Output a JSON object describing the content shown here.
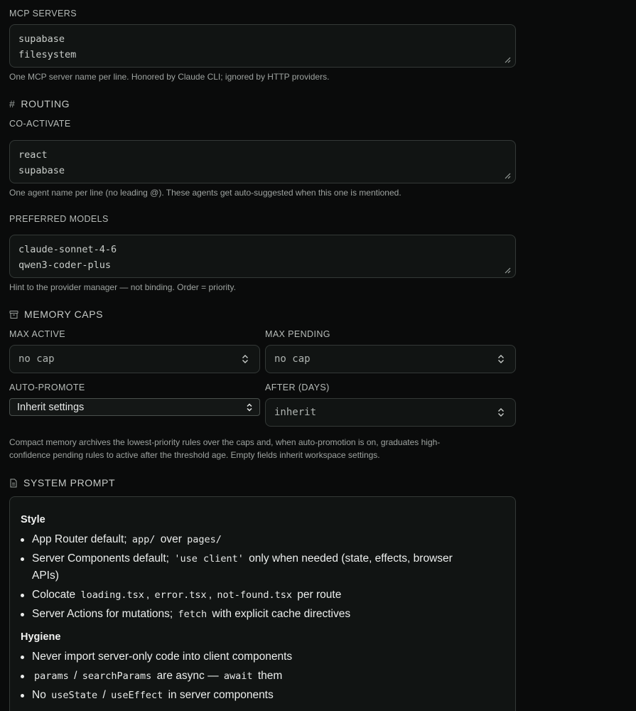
{
  "mcp": {
    "label": "MCP SERVERS",
    "lines": [
      "supabase",
      "filesystem"
    ],
    "hint": "One MCP server name per line. Honored by Claude CLI; ignored by HTTP providers."
  },
  "routing": {
    "title": "ROUTING",
    "coactivate_label": "CO-ACTIVATE",
    "coactivate_lines": [
      "react",
      "supabase"
    ],
    "coactivate_hint": "One agent name per line (no leading @). These agents get auto-suggested when this one is mentioned.",
    "models_label": "PREFERRED MODELS",
    "models_lines": [
      "claude-sonnet-4-6",
      "qwen3-coder-plus"
    ],
    "models_hint": "Hint to the provider manager — not binding. Order = priority."
  },
  "memory": {
    "title": "MEMORY CAPS",
    "max_active_label": "MAX ACTIVE",
    "max_active_placeholder": "no cap",
    "max_pending_label": "MAX PENDING",
    "max_pending_placeholder": "no cap",
    "auto_promote_label": "AUTO-PROMOTE",
    "auto_promote_value": "Inherit settings",
    "after_label": "AFTER (DAYS)",
    "after_placeholder": "inherit",
    "hint_line1": "Compact memory archives the lowest-priority rules over the caps and, when auto-promotion is on, graduates high-",
    "hint_line2": "confidence pending rules to active after the threshold age. Empty fields inherit workspace settings."
  },
  "system_prompt": {
    "title": "SYSTEM PROMPT",
    "style_heading": "Style",
    "s1": {
      "a": "App Router default;",
      "c1": "app/",
      "b": "over",
      "c2": "pages/"
    },
    "s2": {
      "a": "Server Components default;",
      "c1": "'use client'",
      "b": "only when needed (state, effects, browser",
      "c": "APIs)"
    },
    "s3": {
      "a": "Colocate",
      "c1": "loading.tsx",
      "c2": "error.tsx",
      "c3": "not-found.tsx",
      "b": "per route"
    },
    "s4": {
      "a": "Server Actions for mutations;",
      "c1": "fetch",
      "b": "with explicit cache directives"
    },
    "hygiene_heading": "Hygiene",
    "h1": "Never import server-only code into client components",
    "h2": {
      "c1": "params",
      "c2": "searchParams",
      "a": "are async —",
      "c3": "await",
      "b": "them"
    },
    "h3": {
      "a": "No",
      "c1": "useState",
      "c2": "useEffect",
      "b": "in server components"
    }
  }
}
